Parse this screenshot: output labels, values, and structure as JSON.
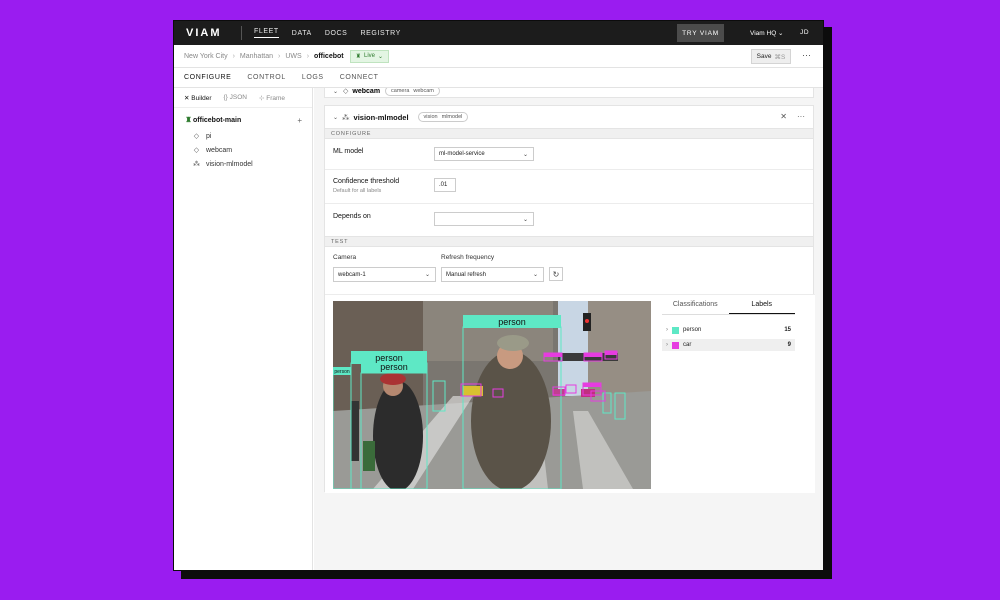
{
  "topbar": {
    "logo": "VIAM",
    "nav": [
      "FLEET",
      "DATA",
      "DOCS",
      "REGISTRY"
    ],
    "try_label": "TRY VIAM",
    "org": "Viam HQ ⌄",
    "user_initials": "JD"
  },
  "breadcrumb": {
    "items": [
      "New York City",
      "Manhattan",
      "UWS"
    ],
    "current": "officebot",
    "status": "Live",
    "save_label": "Save",
    "save_shortcut": "⌘S"
  },
  "tabs": [
    "CONFIGURE",
    "CONTROL",
    "LOGS",
    "CONNECT"
  ],
  "sidebar": {
    "view_tabs": [
      "Builder",
      "JSON",
      "Frame"
    ],
    "root": "officebot-main",
    "items": [
      "pi",
      "webcam",
      "vision-mlmodel"
    ]
  },
  "webcam_card": {
    "name": "webcam",
    "chips": [
      "camera",
      "webcam"
    ]
  },
  "vision_card": {
    "name": "vision-mlmodel",
    "chips": [
      "vision",
      "mlmodel"
    ],
    "configure_label": "CONFIGURE",
    "ml_model_label": "ML model",
    "ml_model_value": "ml-model-service",
    "confidence_label": "Confidence threshold",
    "confidence_sub": "Default for all labels",
    "confidence_value": ".01",
    "depends_label": "Depends on",
    "depends_value": "",
    "test_label": "TEST",
    "camera_label": "Camera",
    "camera_value": "webcam-1",
    "refresh_label": "Refresh frequency",
    "refresh_value": "Manual refresh"
  },
  "detections": {
    "labels": [
      "person",
      "person",
      "person",
      "person",
      "car"
    ]
  },
  "results": {
    "tabs": [
      "Classifications",
      "Labels"
    ],
    "labels": [
      {
        "name": "person",
        "count": "15",
        "color": "#5ee8c5"
      },
      {
        "name": "car",
        "count": "9",
        "color": "#e63ce0"
      }
    ]
  }
}
